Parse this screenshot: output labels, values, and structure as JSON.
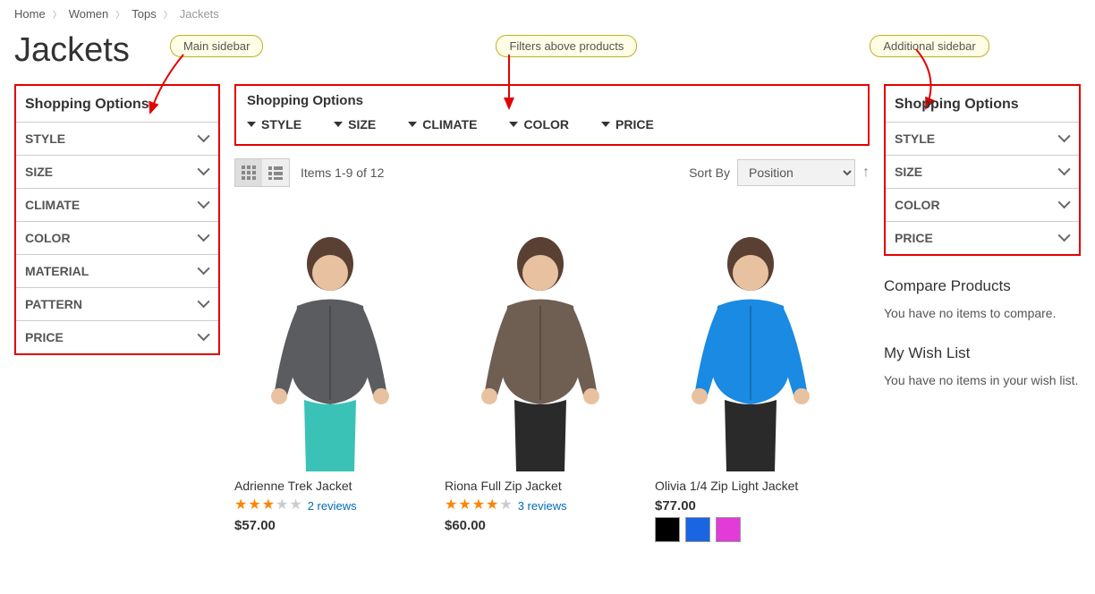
{
  "breadcrumbs": {
    "home": "Home",
    "women": "Women",
    "tops": "Tops",
    "current": "Jackets"
  },
  "page_title": "Jackets",
  "callouts": {
    "main": "Main sidebar",
    "above": "Filters above products",
    "additional": "Additional sidebar"
  },
  "left_sidebar": {
    "title": "Shopping Options",
    "filters": [
      "STYLE",
      "SIZE",
      "CLIMATE",
      "COLOR",
      "MATERIAL",
      "PATTERN",
      "PRICE"
    ]
  },
  "top_filters": {
    "title": "Shopping Options",
    "opts": [
      "STYLE",
      "SIZE",
      "CLIMATE",
      "COLOR",
      "PRICE"
    ]
  },
  "toolbar": {
    "items_text": "Items 1-9 of 12",
    "sort_label": "Sort By",
    "sort_value": "Position"
  },
  "products": [
    {
      "name": "Adrienne Trek Jacket",
      "rating": 3,
      "reviews": "2 reviews",
      "price": "$57.00",
      "shirt": "#5b5c5f",
      "pants": "#3ac2b7"
    },
    {
      "name": "Riona Full Zip Jacket",
      "rating": 4,
      "reviews": "3 reviews",
      "price": "$60.00",
      "shirt": "#6f5e52",
      "pants": "#2a2a2a"
    },
    {
      "name": "Olivia 1/4 Zip Light Jacket",
      "rating": 0,
      "reviews": "",
      "price": "$77.00",
      "shirt": "#1a8ae2",
      "pants": "#2a2a2a",
      "swatches": [
        "#000000",
        "#1a66e2",
        "#e23bd8"
      ]
    }
  ],
  "right_sidebar": {
    "title": "Shopping Options",
    "filters": [
      "STYLE",
      "SIZE",
      "COLOR",
      "PRICE"
    ],
    "compare_title": "Compare Products",
    "compare_text": "You have no items to compare.",
    "wishlist_title": "My Wish List",
    "wishlist_text": "You have no items in your wish list."
  }
}
